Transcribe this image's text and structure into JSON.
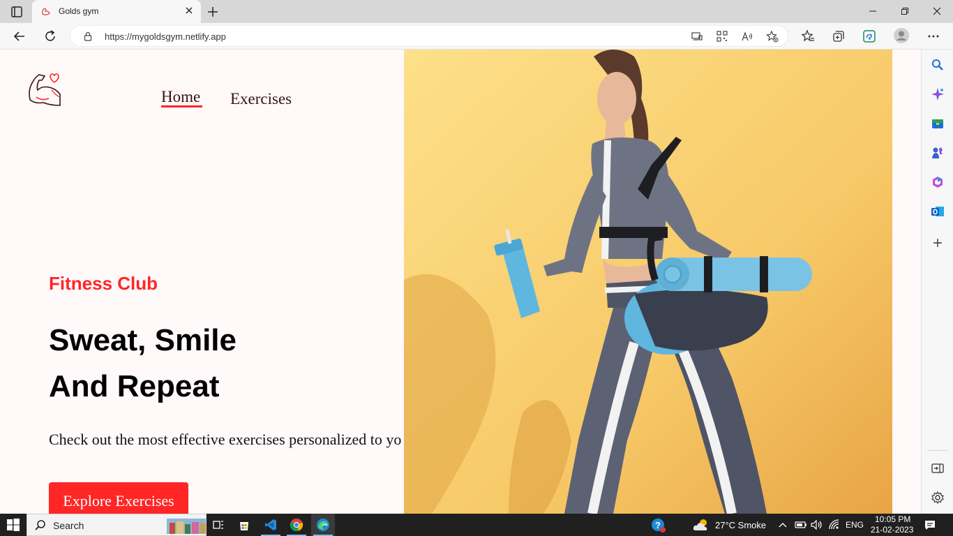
{
  "browser": {
    "tab_title": "Golds gym",
    "url": "https://mygoldsgym.netlify.app"
  },
  "nav": {
    "home": "Home",
    "exercises": "Exercises"
  },
  "hero": {
    "eyebrow": "Fitness Club",
    "headline_line1": "Sweat, Smile",
    "headline_line2": "And Repeat",
    "description": "Check out the most effective exercises personalized to yo",
    "cta": "Explore Exercises"
  },
  "taskbar": {
    "search_label": "Search",
    "weather": "27°C  Smoke",
    "language": "ENG",
    "time": "10:05 PM",
    "date": "21-02-2023"
  },
  "colors": {
    "accent": "#ff2625",
    "page_bg": "#fff9fa",
    "hero_bg": "#f7c968"
  }
}
